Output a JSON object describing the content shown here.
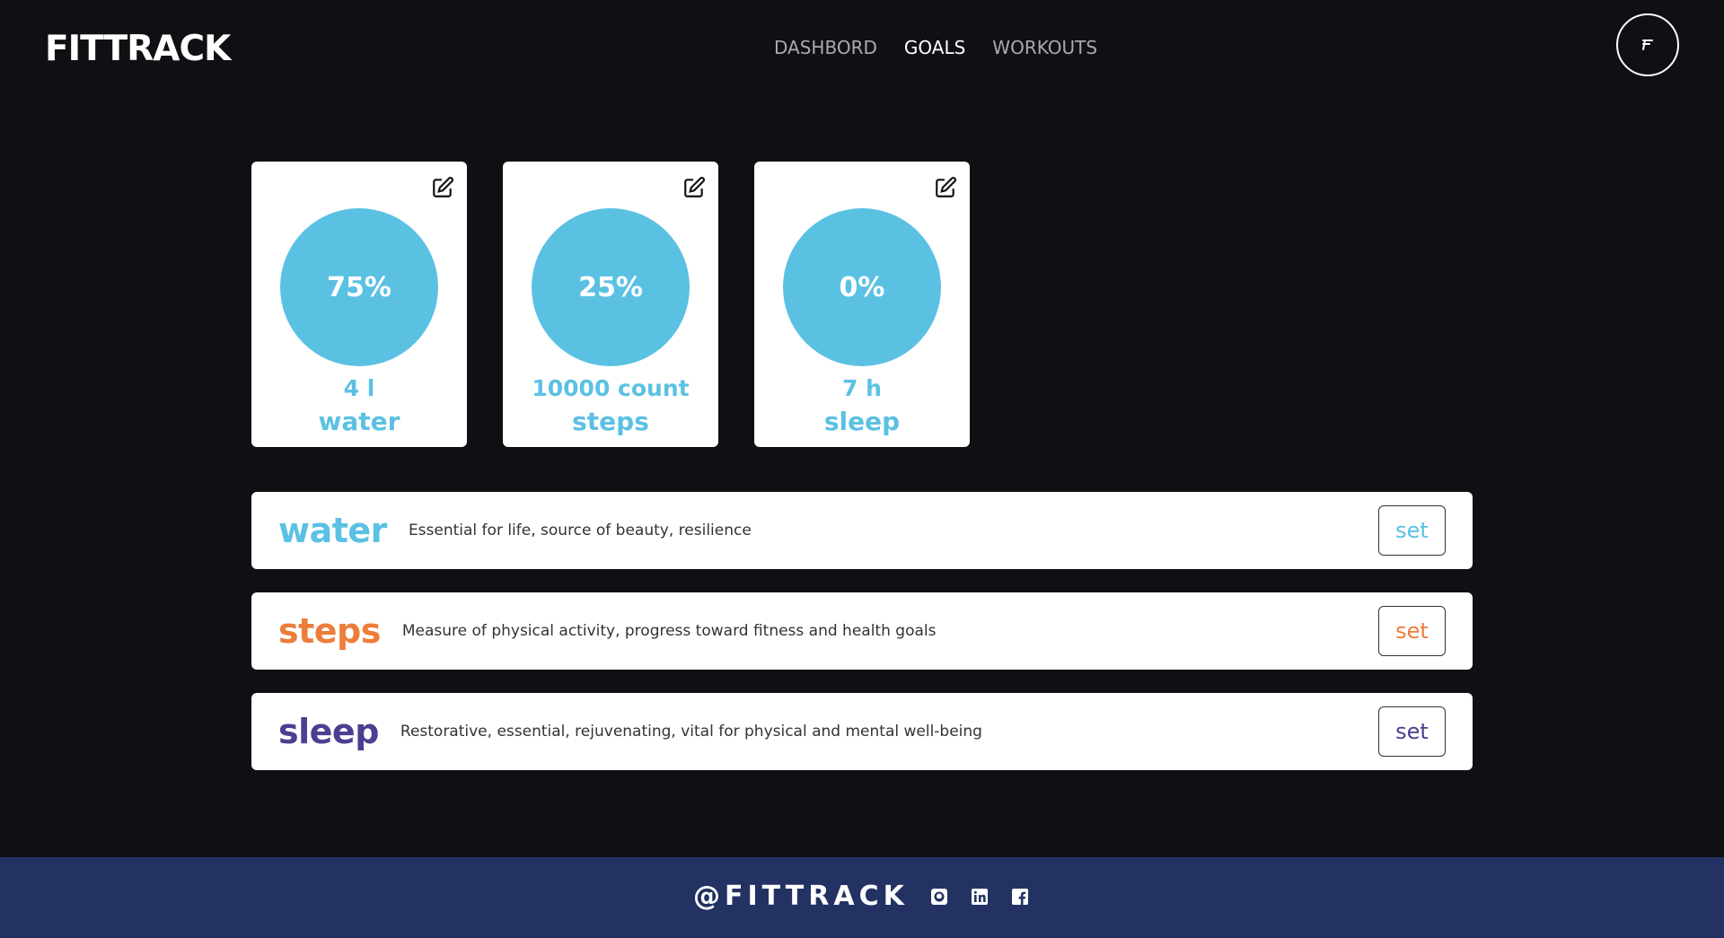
{
  "header": {
    "logo": "FITTRACK",
    "nav": [
      {
        "label": "DASHBORD",
        "active": false
      },
      {
        "label": "GOALS",
        "active": true
      },
      {
        "label": "WORKOUTS",
        "active": false
      }
    ],
    "avatar_icon": "brand-f-icon"
  },
  "colors": {
    "background": "#101014",
    "accent": "#5bc1e3",
    "water": "#5bc1e3",
    "steps": "#ed7d3a",
    "sleep": "#4b3f91",
    "footer": "#233262"
  },
  "cards": [
    {
      "percent": "75%",
      "progress": 0.75,
      "target": "4 l",
      "name": "water",
      "icon": "edit-icon"
    },
    {
      "percent": "25%",
      "progress": 0.25,
      "target": "10000 count",
      "name": "steps",
      "icon": "edit-icon"
    },
    {
      "percent": "0%",
      "progress": 0,
      "target": "7 h",
      "name": "sleep",
      "icon": "edit-icon"
    }
  ],
  "rows": [
    {
      "name": "water",
      "description": "Essential for life, source of beauty, resilience",
      "button": "set"
    },
    {
      "name": "steps",
      "description": "Measure of physical activity, progress toward fitness and health goals",
      "button": "set"
    },
    {
      "name": "sleep",
      "description": "Restorative, essential, rejuvenating, vital for physical and mental well-being",
      "button": "set"
    }
  ],
  "footer": {
    "brand": "@FITTRACK",
    "social": [
      "github-icon",
      "linkedin-icon",
      "facebook-icon"
    ]
  }
}
